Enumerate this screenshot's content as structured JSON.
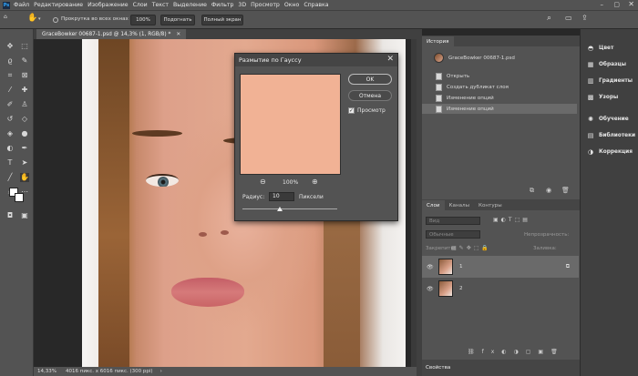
{
  "menubar": {
    "logo": "Ps",
    "items": [
      "Файл",
      "Редактирование",
      "Изображение",
      "Слои",
      "Текст",
      "Выделение",
      "Фильтр",
      "3D",
      "Просмотр",
      "Окно",
      "Справка"
    ]
  },
  "options": {
    "scroll_all_label": "Прокрутка во всех окнах",
    "zoom_button": "100%",
    "fit_button": "Подогнать",
    "fullscreen_button": "Полный экран"
  },
  "document": {
    "tab_title": "GraceBowker 00687-1.psd @ 14,3% (1, RGB/8) *",
    "status_zoom": "14,33%",
    "status_info": "4016 пикс. x 6016 пикс. (300 ppi)"
  },
  "dialog": {
    "title": "Размытие по Гауссу",
    "ok": "OK",
    "cancel": "Отмена",
    "preview_label": "Просмотр",
    "preview_checked": true,
    "zoom_value": "100%",
    "radius_label": "Радиус:",
    "radius_value": "10",
    "radius_unit": "Пиксели"
  },
  "history": {
    "tab": "История",
    "snapshot": "GraceBowker 00687-1.psd",
    "items": [
      "Открыть",
      "Создать дубликат слоя",
      "Изменение опций",
      "Изменение опций"
    ]
  },
  "layers": {
    "tabs": [
      "Слои",
      "Каналы",
      "Контуры"
    ],
    "search_placeholder": "Вид",
    "blend_mode": "Обычные",
    "opacity_label": "Непрозрачность:",
    "lock_label": "Закрепить:",
    "fill_label": "Заливка:",
    "rows": [
      {
        "name": "1"
      },
      {
        "name": "2"
      }
    ]
  },
  "dock": {
    "items": [
      "Цвет",
      "Образцы",
      "Градиенты",
      "Узоры",
      "Обучение",
      "Библиотеки",
      "Коррекция"
    ],
    "properties": "Свойства"
  },
  "colors": {
    "ui_dark": "#535353",
    "ui_darker": "#404040",
    "accent_blue": "#31a8ff"
  }
}
